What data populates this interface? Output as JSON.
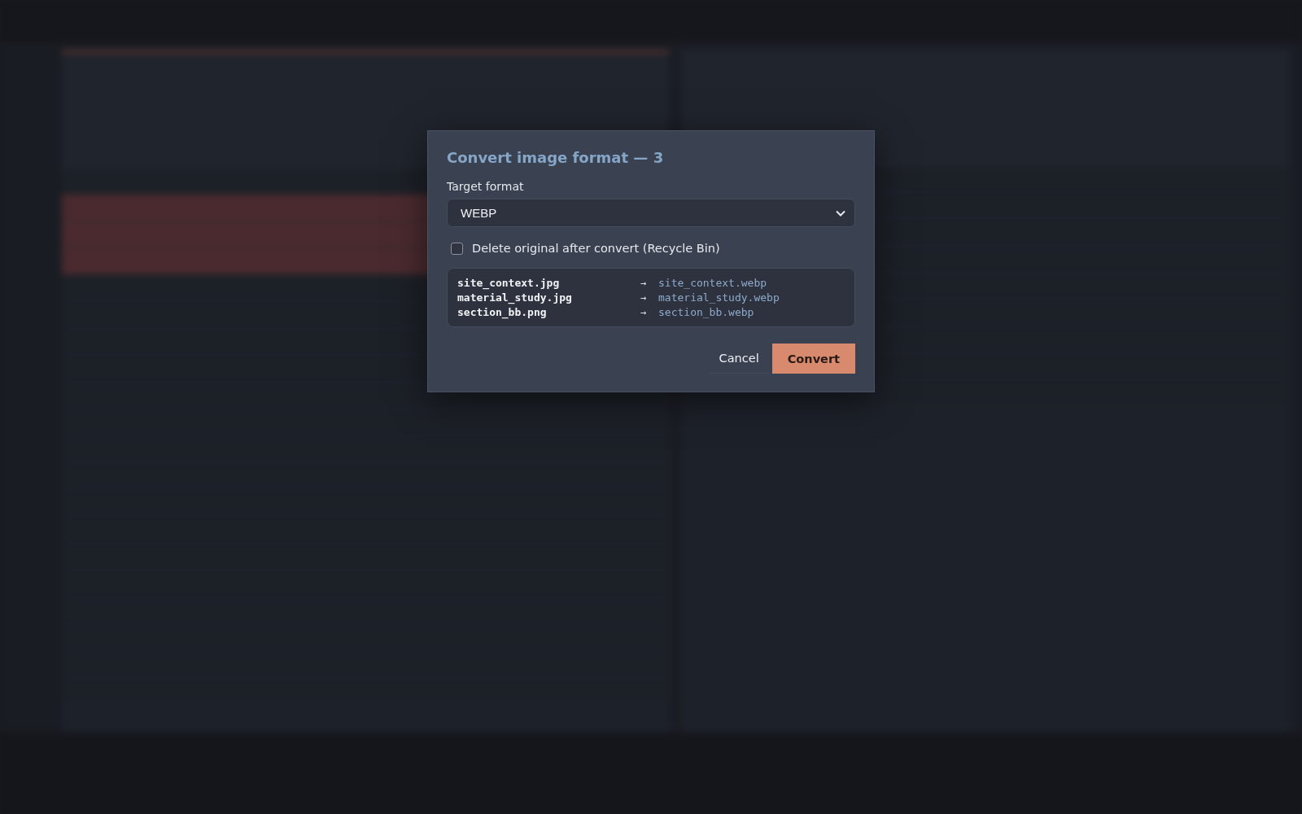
{
  "dialog": {
    "title": "Convert image format — 3",
    "format_label": "Target format",
    "format_value": "WEBP",
    "delete_original": {
      "label": "Delete original after convert (Recycle Bin)",
      "checked": false
    },
    "conversions": [
      {
        "source": "site_context.jpg",
        "arrow": "→",
        "target": "site_context.webp"
      },
      {
        "source": "material_study.jpg",
        "arrow": "→",
        "target": "material_study.webp"
      },
      {
        "source": "section_bb.png",
        "arrow": "→",
        "target": "section_bb.webp"
      }
    ],
    "buttons": [
      {
        "label": "Cancel",
        "kind": "secondary"
      },
      {
        "label": "Convert",
        "kind": "primary"
      }
    ]
  }
}
